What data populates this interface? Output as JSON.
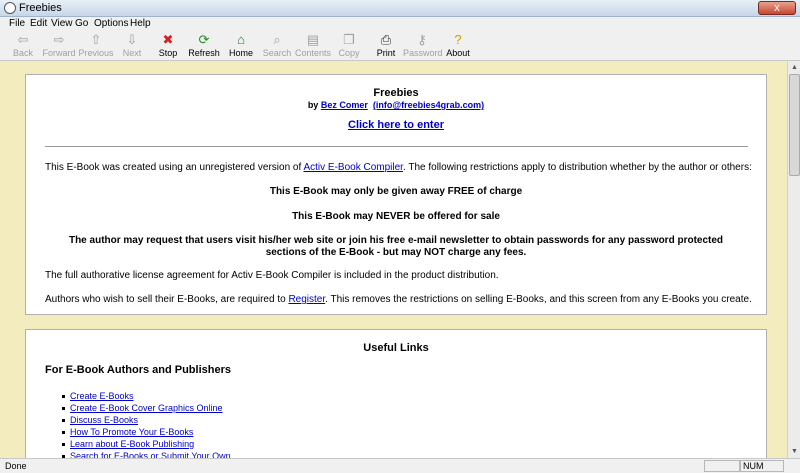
{
  "window": {
    "title": "Freebies",
    "close": "x"
  },
  "menu": [
    "File",
    "Edit",
    "View",
    "Go",
    "Options",
    "Help"
  ],
  "toolbar": [
    {
      "label": "Back",
      "icon": "back-arrow-icon",
      "glyph": "⇦",
      "enabled": false
    },
    {
      "label": "Forward",
      "icon": "forward-arrow-icon",
      "glyph": "⇨",
      "enabled": false
    },
    {
      "label": "Previous",
      "icon": "up-arrow-icon",
      "glyph": "⇧",
      "enabled": false
    },
    {
      "label": "Next",
      "icon": "down-arrow-icon",
      "glyph": "⇩",
      "enabled": false
    },
    {
      "label": "Stop",
      "icon": "stop-icon",
      "glyph": "✖",
      "enabled": true,
      "color": "#d81e1e"
    },
    {
      "label": "Refresh",
      "icon": "refresh-icon",
      "glyph": "⟳",
      "enabled": true,
      "color": "#2a8a2a"
    },
    {
      "label": "Home",
      "icon": "home-icon",
      "glyph": "⌂",
      "enabled": true,
      "color": "#2a7a2a"
    },
    {
      "label": "Search",
      "icon": "search-icon",
      "glyph": "⌕",
      "enabled": false
    },
    {
      "label": "Contents",
      "icon": "contents-icon",
      "glyph": "▤",
      "enabled": false
    },
    {
      "label": "Copy",
      "icon": "copy-icon",
      "glyph": "❐",
      "enabled": false
    },
    {
      "label": "Print",
      "icon": "printer-icon",
      "glyph": "⎙",
      "enabled": true,
      "color": "#333333"
    },
    {
      "label": "Password",
      "icon": "key-icon",
      "glyph": "⚷",
      "enabled": false
    },
    {
      "label": "About",
      "icon": "help-icon",
      "glyph": "?",
      "enabled": true,
      "color": "#c8a000"
    }
  ],
  "content": {
    "title": "Freebies",
    "by": "by",
    "author": "Bez Comer",
    "email": "(info@freebies4grab.com)",
    "enter": "Click here to enter",
    "intro_pre": "This E-Book was created using an unregistered version of",
    "compiler_link": "Activ E-Book Compiler",
    "intro_post": ". The following restrictions apply to distribution whether by the author or others:",
    "r1": "This E-Book may only be given away FREE of charge",
    "r2": "This E-Book may NEVER be offered for sale",
    "r3a": "The author may request that users visit his/her web site or join his free e-mail newsletter to obtain passwords for any password protected",
    "r3b": "sections of the E-Book - but may NOT charge any fees.",
    "license": "The full authorative license agreement for Activ E-Book Compiler is included in the product distribution.",
    "sell_pre": "Authors who wish to sell their E-Books, are required to",
    "register": "Register",
    "sell_post": ". This removes the restrictions on selling E-Books, and this screen from any E-Books you create.",
    "useful": "Useful Links",
    "for_authors": "For E-Book Authors and Publishers",
    "links": [
      "Create E-Books",
      "Create E-Book Cover Graphics Online",
      "Discuss E-Books",
      "How To Promote Your E-Books",
      "Learn about E-Book Publishing",
      "Search for E-Books or Submit Your Own"
    ]
  },
  "status": {
    "text": "Done",
    "num": "NUM"
  }
}
